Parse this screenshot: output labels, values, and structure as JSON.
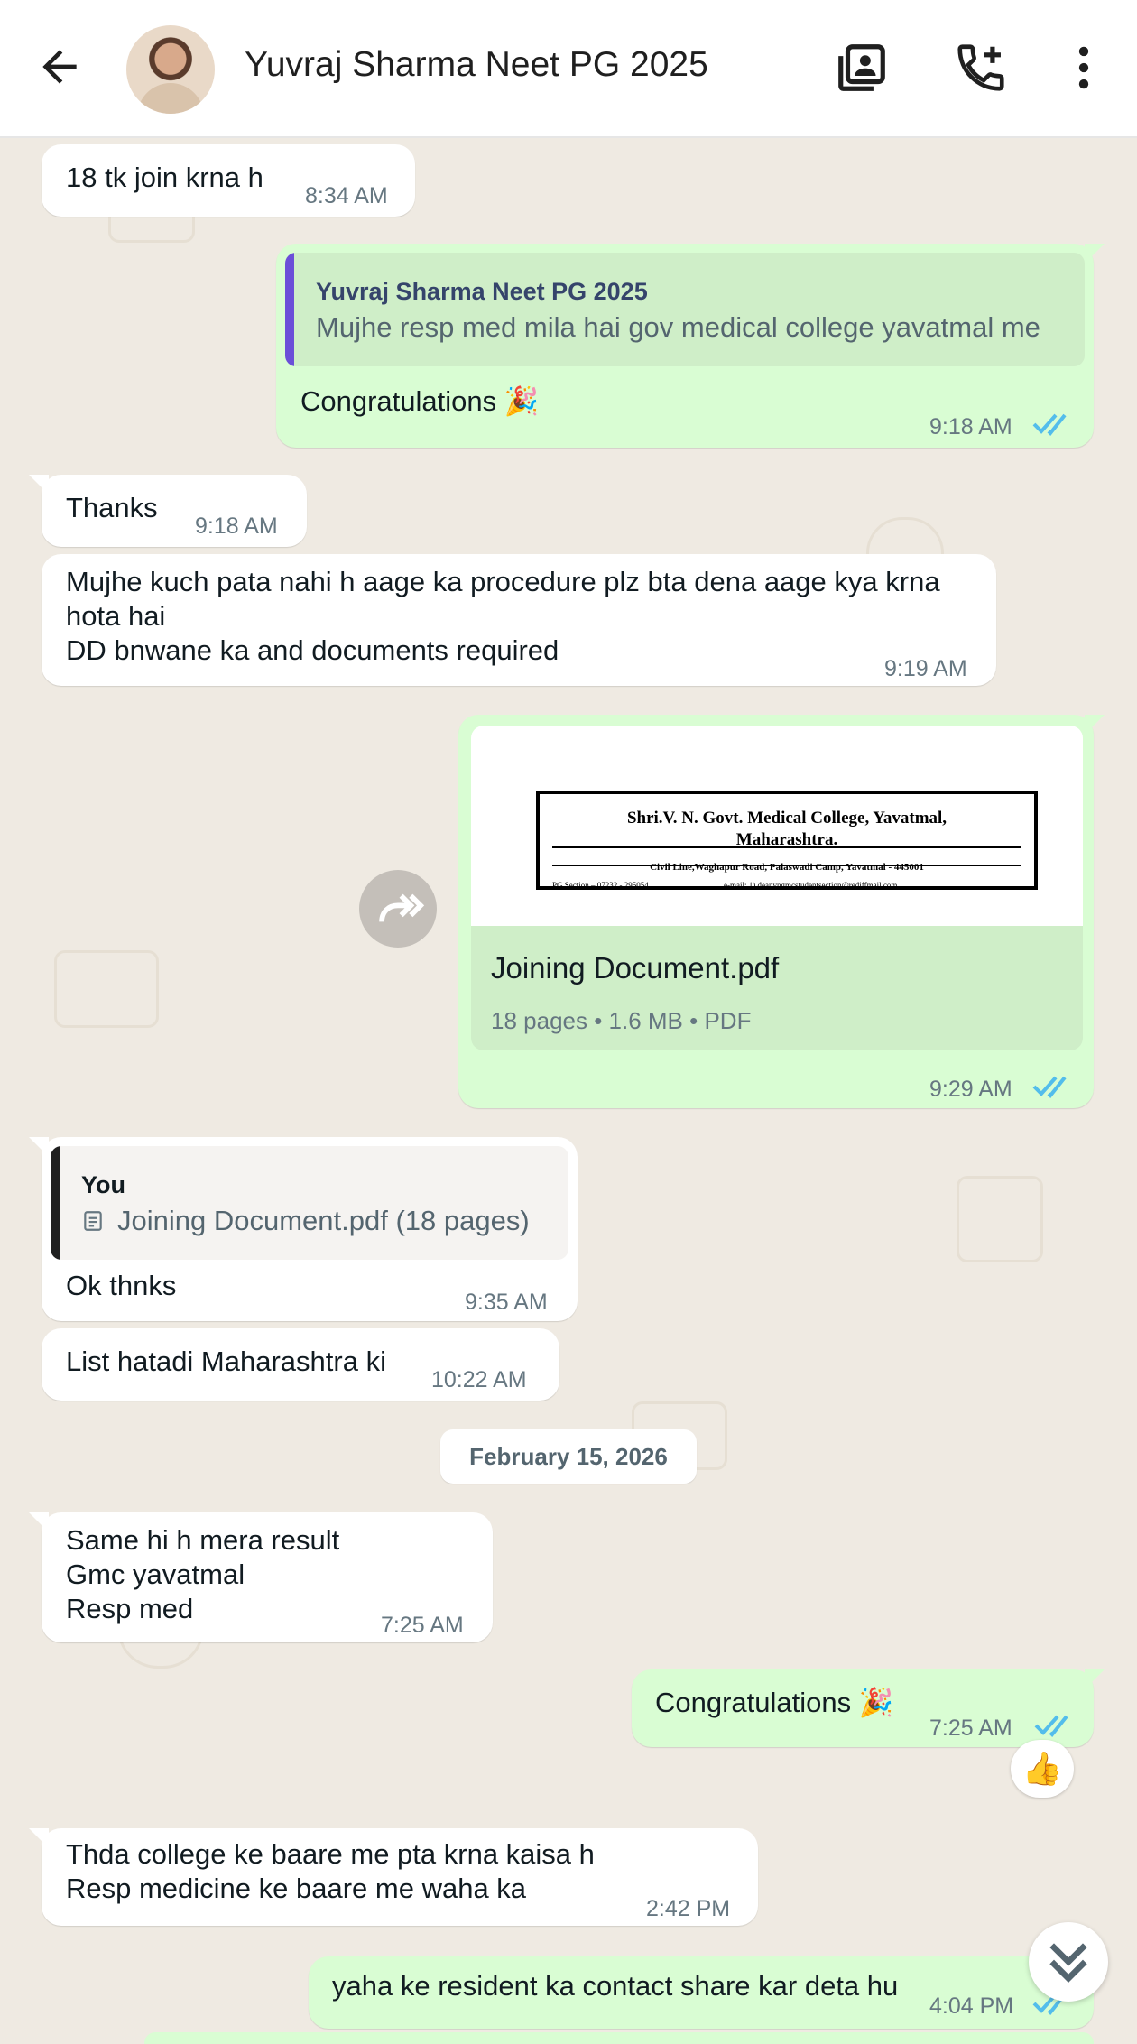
{
  "header": {
    "contact_name": "Yuvraj Sharma Neet PG 2025",
    "icons": [
      "back-arrow-icon",
      "avatar",
      "contact-card-icon",
      "add-call-icon",
      "more-vert-icon"
    ]
  },
  "colors": {
    "incoming_bubble": "#ffffff",
    "outgoing_bubble": "#d9fdd3",
    "read_ticks": "#53bdeb",
    "wallpaper": "#efeae2"
  },
  "messages": [
    {
      "text": "18 tk join krna h",
      "time": "8:34 AM"
    },
    {
      "quote_author": "Yuvraj Sharma Neet PG 2025",
      "quote_text": "Mujhe resp med mila hai gov medical college yavatmal me",
      "text": "Congratulations 🎉",
      "time": "9:18 AM"
    },
    {
      "text": "Thanks",
      "time": "9:18 AM"
    },
    {
      "text": "Mujhe kuch pata nahi h aage ka procedure plz bta dena aage kya krna\nhota hai\nDD bnwane ka and documents required",
      "time": "9:19 AM"
    },
    {
      "document": {
        "preview_line1": "Shri.V. N. Govt.  Medical College, Yavatmal,",
        "preview_line2": "Maharashtra.",
        "preview_line3": "Civil Line,Waghapur Road, Palaswadi Camp, Yavatmal - 445001",
        "preview_line4_left": "PG Section – 07232 - 295054",
        "preview_line4_right": "e-mail: 1) deanvngmcstudentsection@rediffmail.com,",
        "name": "Joining Document.pdf",
        "meta": "18 pages • 1.6 MB • PDF"
      },
      "time": "9:29 AM"
    },
    {
      "quote_author": "You",
      "quote_text": "Joining Document.pdf (18 pages)",
      "text": "Ok thnks",
      "time": "9:35 AM"
    },
    {
      "text": "List hatadi Maharashtra ki",
      "time": "10:22 AM"
    },
    {
      "text": "Same hi h mera result\nGmc yavatmal\nResp med",
      "time": "7:25 AM"
    },
    {
      "text": "Congratulations 🎉",
      "time": "7:25 AM",
      "reaction": "👍"
    },
    {
      "text": "Thda college ke baare me pta krna kaisa h\nResp medicine ke baare me waha ka",
      "time": "2:42 PM"
    },
    {
      "text": "yaha ke resident ka contact share kar deta hu",
      "time": "4:04 PM"
    }
  ],
  "date_separator": "February 15, 2026"
}
